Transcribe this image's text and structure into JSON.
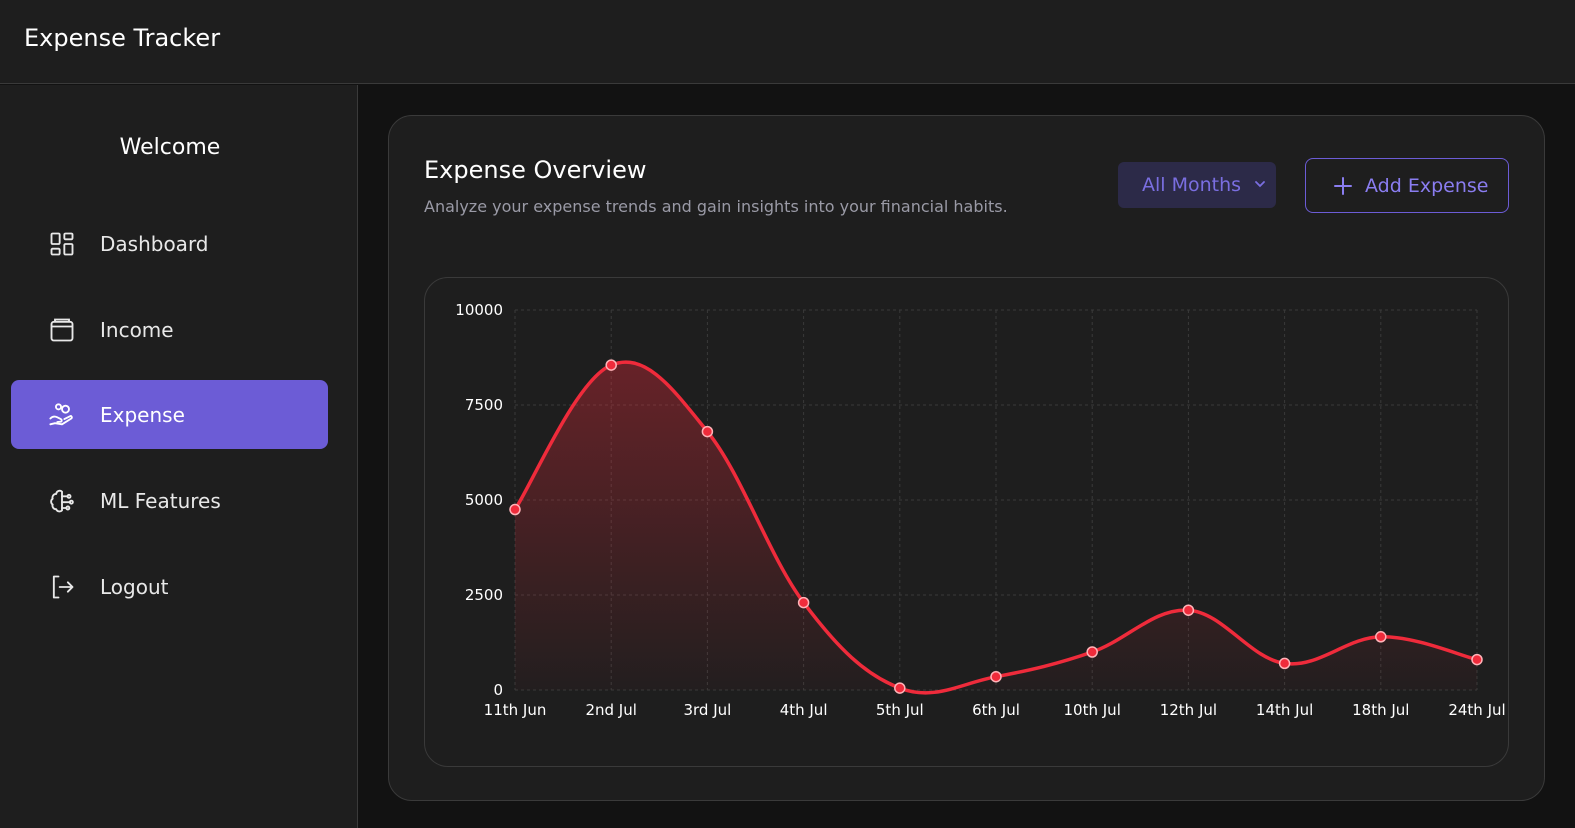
{
  "app": {
    "title": "Expense Tracker"
  },
  "sidebar": {
    "welcome": "Welcome",
    "items": [
      {
        "label": "Dashboard",
        "icon": "dashboard-icon",
        "active": false
      },
      {
        "label": "Income",
        "icon": "wallet-icon",
        "active": false
      },
      {
        "label": "Expense",
        "icon": "hand-coins-icon",
        "active": true
      },
      {
        "label": "ML Features",
        "icon": "brain-icon",
        "active": false
      },
      {
        "label": "Logout",
        "icon": "logout-icon",
        "active": false
      }
    ]
  },
  "main": {
    "title": "Expense Overview",
    "subtitle": "Analyze your expense trends and gain insights into your financial habits.",
    "month_filter": {
      "selected": "All Months"
    },
    "add_button": "Add Expense"
  },
  "colors": {
    "accent": "#6c5cd6",
    "line": "#ef2b3b",
    "background": "#121212",
    "panel": "#1e1e1e"
  },
  "chart_data": {
    "type": "area",
    "categories": [
      "11th Jun",
      "2nd Jul",
      "3rd Jul",
      "4th Jul",
      "5th Jul",
      "6th Jul",
      "10th Jul",
      "12th Jul",
      "14th Jul",
      "18th Jul",
      "24th Jul"
    ],
    "series": [
      {
        "values": [
          4750,
          8550,
          6800,
          2300,
          50,
          350,
          1000,
          2100,
          700,
          1400,
          800
        ]
      }
    ],
    "yticks": [
      "0",
      "2500",
      "5000",
      "7500",
      "10000"
    ],
    "ylim": [
      0,
      10000
    ],
    "grid": true,
    "smooth": true
  }
}
